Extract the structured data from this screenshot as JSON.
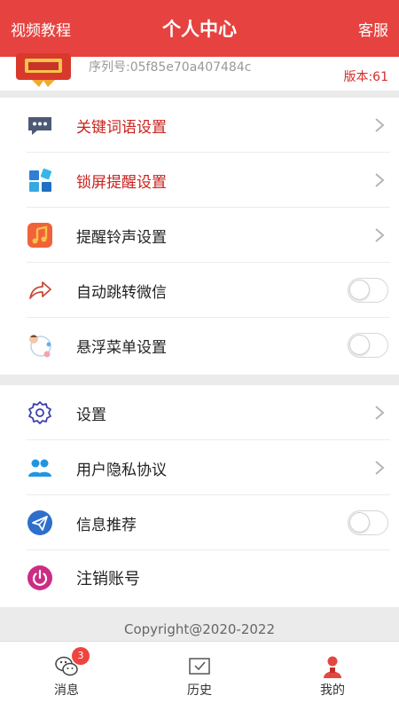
{
  "header": {
    "left": "视频教程",
    "title": "个人中心",
    "right": "客服"
  },
  "profile": {
    "serial": "序列号:05f85e70a407484c",
    "version": "版本:61"
  },
  "menu_group_1": [
    {
      "label": "关键词语设置",
      "control": "chevron",
      "highlight": true,
      "icon": "chat-bubble-icon"
    },
    {
      "label": "锁屏提醒设置",
      "control": "chevron",
      "highlight": true,
      "icon": "apps-grid-icon"
    },
    {
      "label": "提醒铃声设置",
      "control": "chevron",
      "highlight": false,
      "icon": "music-note-icon"
    },
    {
      "label": "自动跳转微信",
      "control": "toggle",
      "toggle_on": false,
      "icon": "share-arrow-icon"
    },
    {
      "label": "悬浮菜单设置",
      "control": "toggle",
      "toggle_on": false,
      "icon": "floating-menu-icon"
    }
  ],
  "menu_group_2": [
    {
      "label": "设置",
      "control": "chevron",
      "icon": "gear-icon"
    },
    {
      "label": "用户隐私协议",
      "control": "chevron",
      "icon": "users-icon"
    },
    {
      "label": "信息推荐",
      "control": "toggle",
      "toggle_on": false,
      "icon": "paper-plane-icon"
    },
    {
      "label": "注销账号",
      "control": "none",
      "icon": "power-icon"
    }
  ],
  "footer": {
    "copyright": "Copyright@2020-2022"
  },
  "tabbar": {
    "items": [
      {
        "label": "消息",
        "badge": "3",
        "icon": "wechat-icon"
      },
      {
        "label": "历史",
        "icon": "mail-icon"
      },
      {
        "label": "我的",
        "icon": "person-icon",
        "active": true
      }
    ]
  },
  "colors": {
    "header": "#e64340",
    "highlight_text": "#c8221e",
    "version": "#d32d2d",
    "badge": "#f0433e"
  }
}
